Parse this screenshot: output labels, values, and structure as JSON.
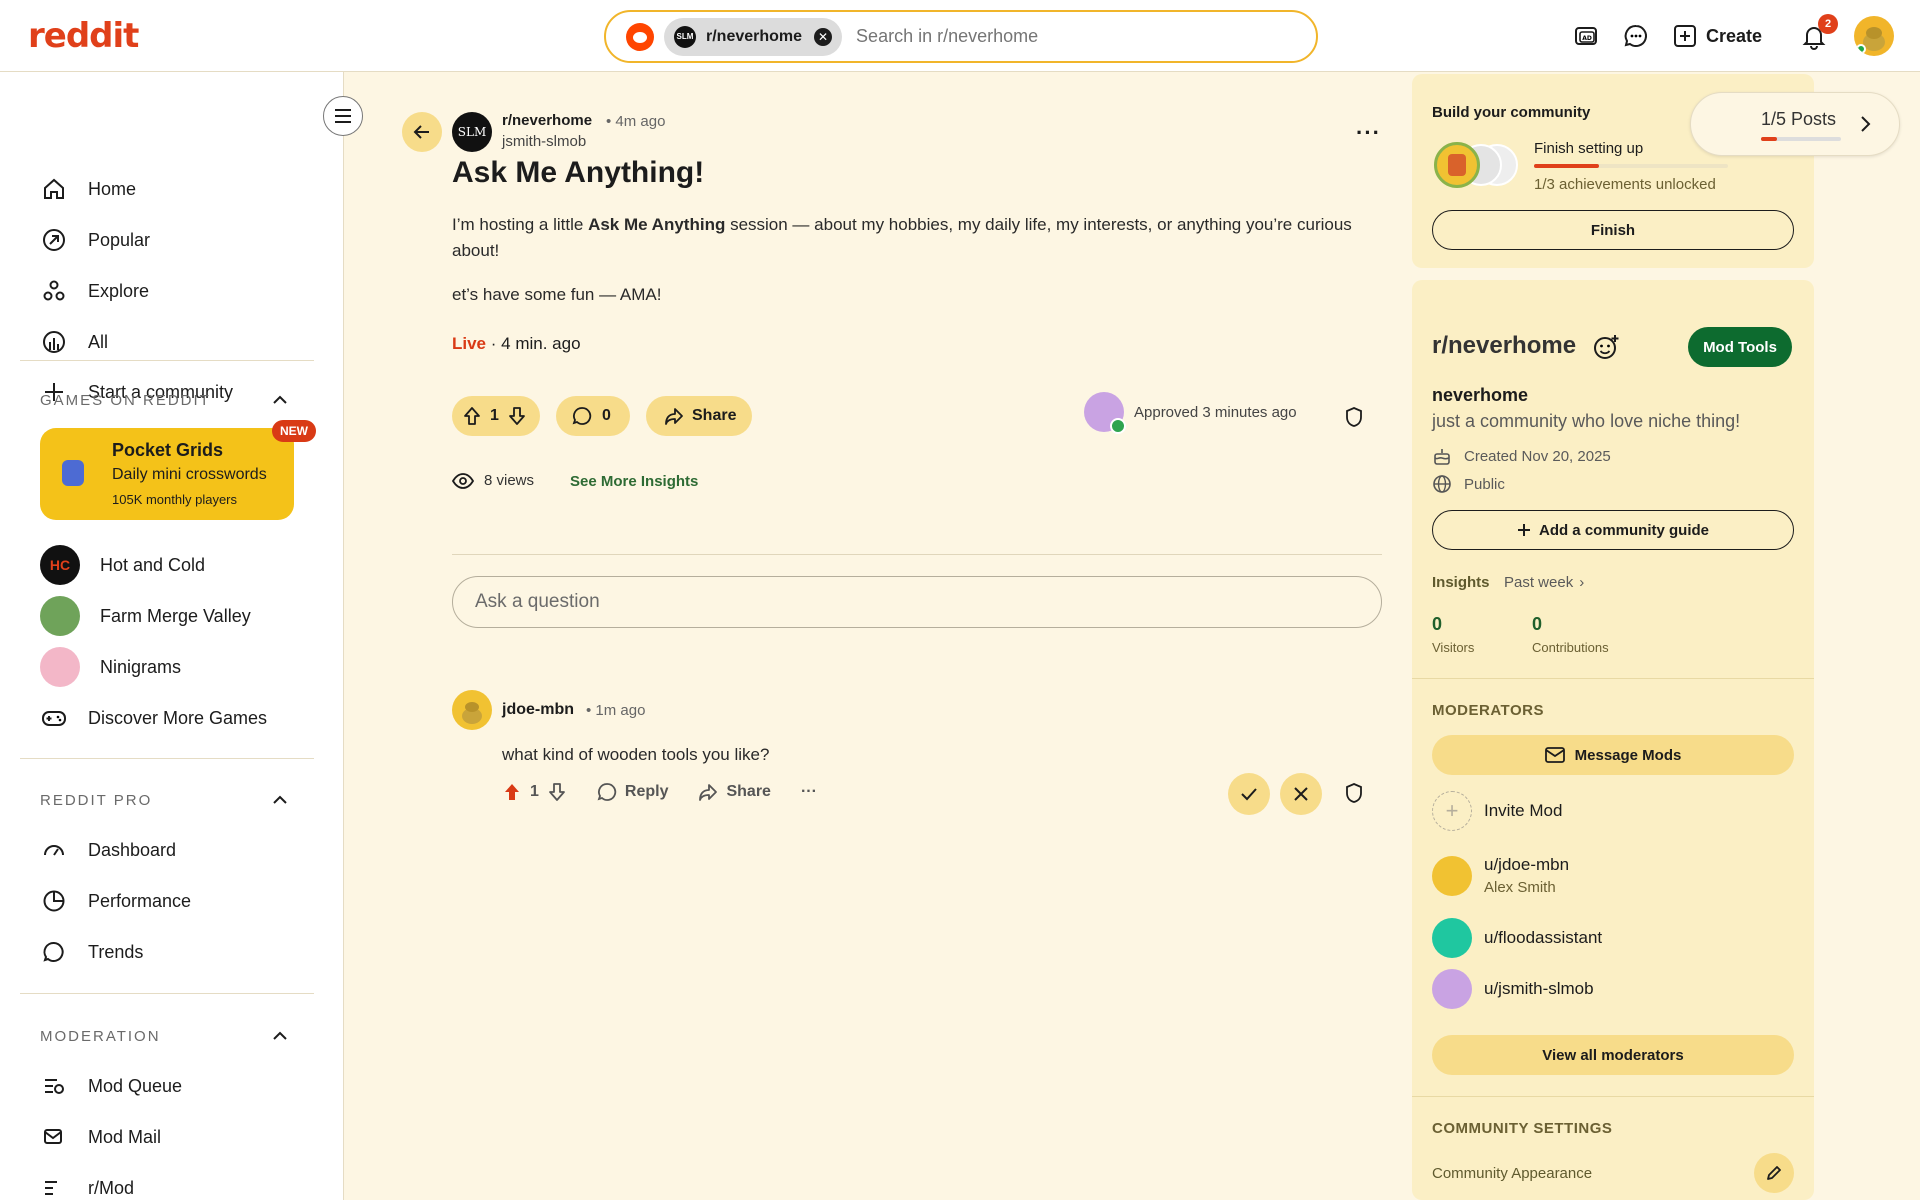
{
  "header": {
    "logo": "reddit",
    "search_chip": "r/neverhome",
    "search_chip_avatar": "SLM",
    "search_placeholder": "Search in r/neverhome",
    "create_label": "Create",
    "notification_count": "2"
  },
  "sidebar": {
    "nav": [
      {
        "label": "Home",
        "icon": "home-icon"
      },
      {
        "label": "Popular",
        "icon": "popular-icon"
      },
      {
        "label": "Explore",
        "icon": "explore-icon"
      },
      {
        "label": "All",
        "icon": "all-icon"
      },
      {
        "label": "Start a community",
        "icon": "plus-icon"
      }
    ],
    "games_section": "GAMES ON REDDIT",
    "featured_game": {
      "title": "Pocket Grids",
      "subtitle": "Daily mini crosswords",
      "meta": "105K monthly players",
      "badge": "NEW"
    },
    "games": [
      {
        "label": "Hot and Cold"
      },
      {
        "label": "Farm Merge Valley"
      },
      {
        "label": "Ninigrams"
      },
      {
        "label": "Discover More Games"
      }
    ],
    "pro_section": "REDDIT PRO",
    "pro": [
      {
        "label": "Dashboard"
      },
      {
        "label": "Performance"
      },
      {
        "label": "Trends"
      }
    ],
    "moderation_section": "MODERATION",
    "moderation": [
      {
        "label": "Mod Queue"
      },
      {
        "label": "Mod Mail"
      },
      {
        "label": "r/Mod"
      }
    ]
  },
  "post": {
    "avatar_text": "SLM",
    "subreddit": "r/neverhome",
    "time": "• 4m ago",
    "author": "jsmith-slmob",
    "title": "Ask Me Anything!",
    "body_pre": "I’m hosting a little ",
    "body_bold": "Ask Me Anything",
    "body_post": " session — about my hobbies, my daily life, my interests, or anything you’re curious about!",
    "body2": "et’s have some fun — AMA!",
    "live": "Live",
    "live_time": " · 4 min. ago",
    "votes": "1",
    "comments": "0",
    "share": "Share",
    "approved": "Approved 3 minutes ago",
    "views": "8 views",
    "insights_link": "See More Insights",
    "ask_placeholder": "Ask a question"
  },
  "comment": {
    "author": "jdoe-mbn",
    "time": "• 1m ago",
    "text": "what kind of wooden tools you like?",
    "votes": "1",
    "reply": "Reply",
    "share": "Share",
    "more": "···"
  },
  "right": {
    "build_title": "Build your community",
    "finish_setup": "Finish setting up",
    "achievements": "1/3 achievements unlocked",
    "achievement_progress": 0.333,
    "finish_btn": "Finish",
    "posts_label": "1/5 Posts",
    "posts_progress": 0.2,
    "community_name": "r/neverhome",
    "mod_tools": "Mod Tools",
    "display_name": "neverhome",
    "description": "just a community who love niche thing!",
    "created": "Created Nov 20, 2025",
    "visibility": "Public",
    "add_guide": "Add a community guide",
    "insights_label": "Insights",
    "insights_range": "Past week",
    "visitors_value": "0",
    "visitors_label": "Visitors",
    "contrib_value": "0",
    "contrib_label": "Contributions",
    "moderators_section": "MODERATORS",
    "message_mods": "Message Mods",
    "invite_mod": "Invite Mod",
    "mods": [
      {
        "name": "u/jdoe-mbn",
        "sub": "Alex Smith",
        "color": "#f1c232"
      },
      {
        "name": "u/floodassistant",
        "sub": "",
        "color": "#1fc7a0"
      },
      {
        "name": "u/jsmith-slmob",
        "sub": "",
        "color": "#c9a3e3"
      }
    ],
    "view_all_mods": "View all moderators",
    "settings_section": "COMMUNITY SETTINGS",
    "appearance": "Community Appearance"
  },
  "colors": {
    "brand": "#e0401a",
    "accent_yellow": "#f7dc8a",
    "mod_green": "#0d6b2f",
    "background": "#fdf6e3"
  }
}
